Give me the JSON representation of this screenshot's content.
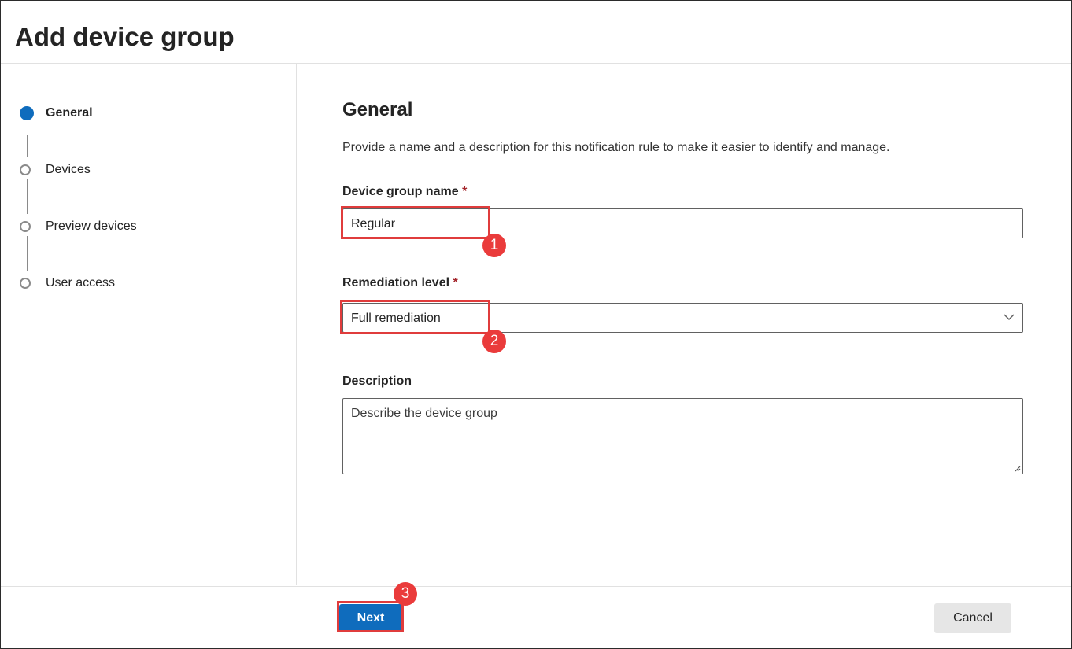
{
  "dialog": {
    "title": "Add device group"
  },
  "steps": [
    {
      "label": "General",
      "state": "active"
    },
    {
      "label": "Devices",
      "state": "pending"
    },
    {
      "label": "Preview devices",
      "state": "pending"
    },
    {
      "label": "User access",
      "state": "pending"
    }
  ],
  "general": {
    "heading": "General",
    "description": "Provide a name and a description for this notification rule to make it easier to identify and manage.",
    "device_group_name": {
      "label": "Device group name",
      "required_mark": "*",
      "value": "Regular"
    },
    "remediation_level": {
      "label": "Remediation level",
      "required_mark": "*",
      "selected": "Full remediation"
    },
    "description_field": {
      "label": "Description",
      "placeholder": "Describe the device group"
    }
  },
  "footer": {
    "next_label": "Next",
    "cancel_label": "Cancel"
  },
  "annotations": {
    "badge_1": "1",
    "badge_2": "2",
    "badge_3": "3"
  },
  "colors": {
    "accent": "#0f6cbd",
    "annotation": "#e03c3c",
    "required": "#a4262c"
  }
}
